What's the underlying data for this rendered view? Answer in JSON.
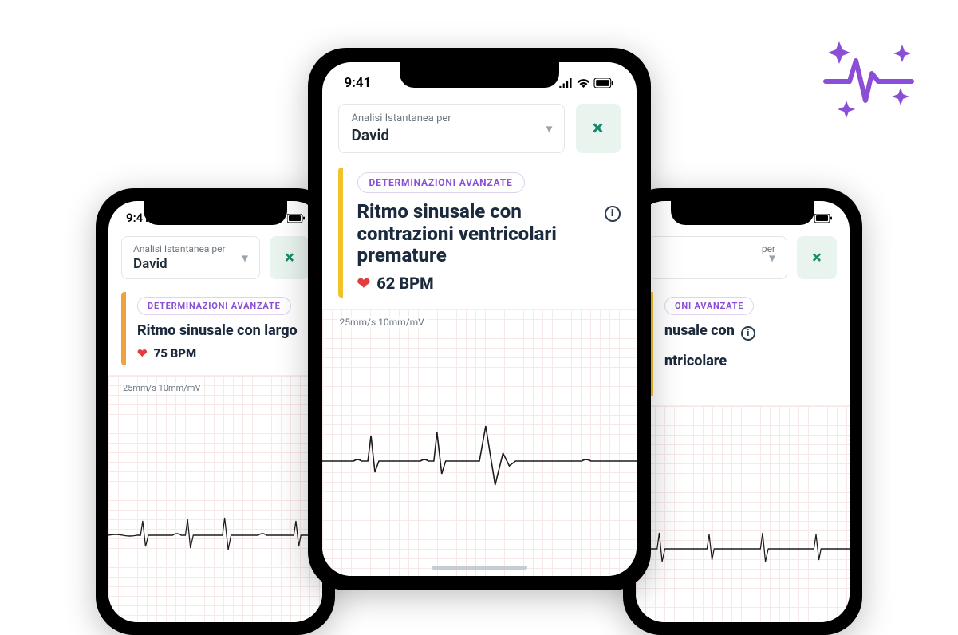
{
  "time": "9:41",
  "analysis_label": "Analisi Istantanea per",
  "patient_name": "David",
  "badge_text": "DETERMINAZIONI AVANZATE",
  "ecg_scale": "25mm/s 10mm/mV",
  "phones": {
    "left": {
      "bar_color": "orange",
      "title": "Ritmo sinusale con largo",
      "bpm": "75 BPM"
    },
    "center": {
      "bar_color": "yellow",
      "title": "Ritmo sinusale con contrazioni ventricolari premature",
      "bpm": "62 BPM"
    },
    "right": {
      "bar_color": "yellow",
      "title_part1": "nusale con",
      "title_part2": "ntricolare",
      "badge_frag": "ONI AVANZATE",
      "analysis_frag": "per"
    }
  },
  "icons": {
    "close": "×",
    "info": "i",
    "caret": "▾",
    "heart": "❤"
  }
}
